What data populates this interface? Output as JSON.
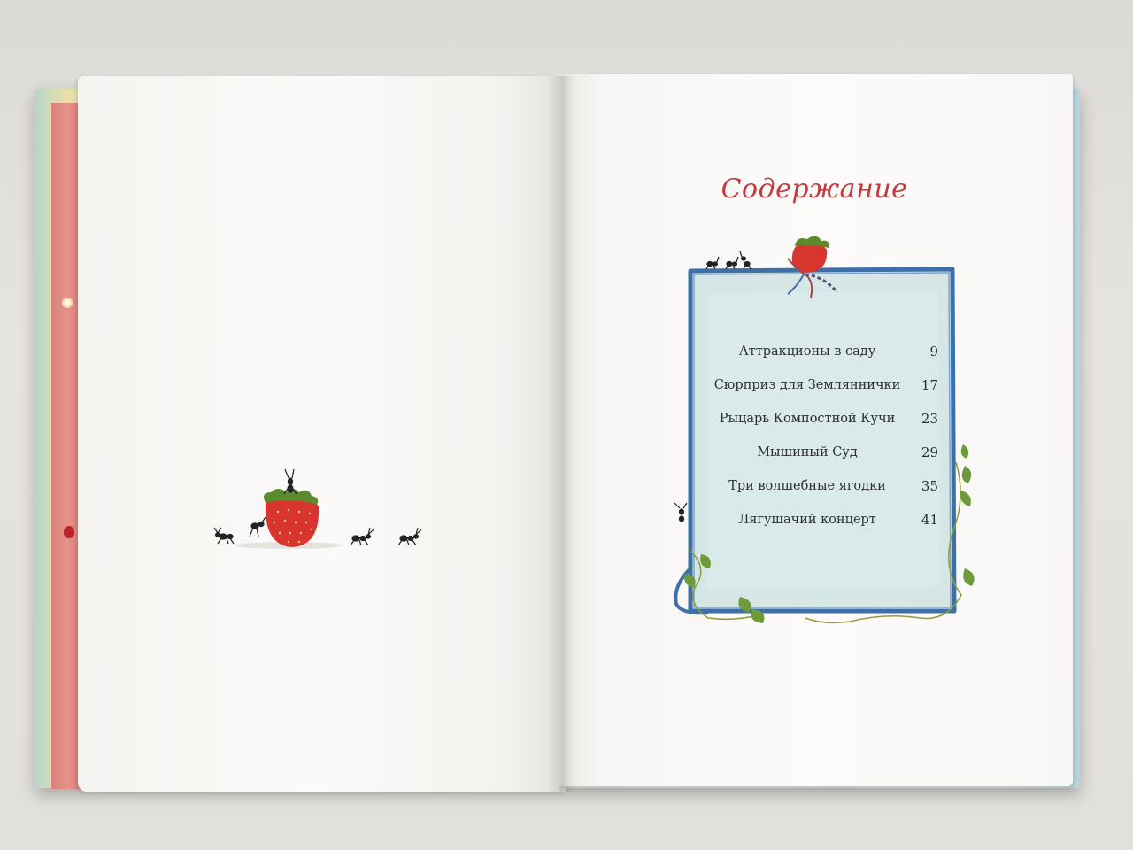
{
  "left_page": {
    "illustration": "strawberry-with-ants"
  },
  "right_page": {
    "title": "Содержание",
    "toc": [
      {
        "title": "Аттракционы в саду",
        "page": "9"
      },
      {
        "title": "Сюрприз для Земляннички",
        "page": "17"
      },
      {
        "title": "Рыцарь Компостной Кучи",
        "page": "23"
      },
      {
        "title": "Мышиный Суд",
        "page": "29"
      },
      {
        "title": "Три волшебные ягодки",
        "page": "35"
      },
      {
        "title": "Лягушачий концерт",
        "page": "41"
      }
    ]
  },
  "colors": {
    "title_red": "#c23a3f",
    "frame_blue": "#3d6fa8",
    "frame_fill": "#cfe3e3",
    "strawberry": "#d9352f",
    "leaf_green": "#6f9a3a"
  }
}
